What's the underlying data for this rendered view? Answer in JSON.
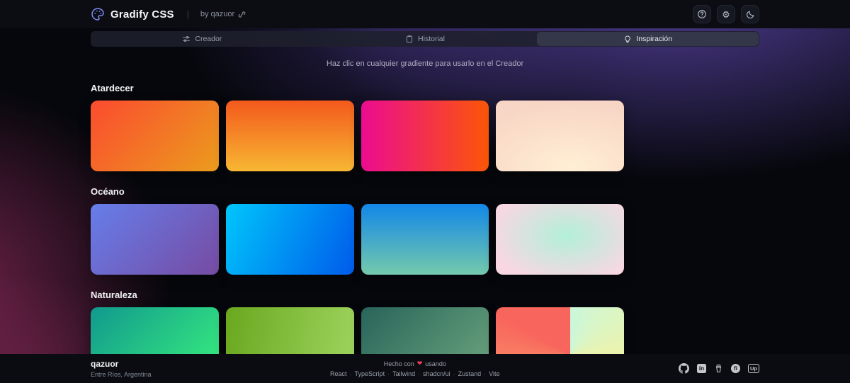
{
  "header": {
    "app_title": "Gradify CSS",
    "separator": "|",
    "byline": "by qazuor",
    "logo_icon": "palette-icon",
    "byline_icon": "link-icon",
    "actions": [
      {
        "icon": "help-icon"
      },
      {
        "icon": "settings-icon"
      },
      {
        "icon": "moon-icon"
      }
    ]
  },
  "tabs": [
    {
      "label": "Creador",
      "icon": "sliders-icon",
      "active": false
    },
    {
      "label": "Historial",
      "icon": "clipboard-icon",
      "active": false
    },
    {
      "label": "Inspiración",
      "icon": "lightbulb-icon",
      "active": true
    }
  ],
  "subtitle": "Haz clic en cualquier gradiente para usarlo en el Creador",
  "sections": [
    {
      "title": "Atardecer",
      "gradients": [
        "linear-gradient(135deg, #fb4b2f 0%, #eb9c1d 100%)",
        "linear-gradient(180deg, #f4591c 0%, #f7b733 100%)",
        "linear-gradient(90deg, #ec0c8f 0%, #fb5607 100%)",
        "radial-gradient(120% 120% at 58% 95%, #ffefd5 0%, #f8d6c5 75%)"
      ]
    },
    {
      "title": "Océano",
      "gradients": [
        "linear-gradient(135deg, #667eea 0%, #764ba2 100%)",
        "linear-gradient(115deg, #00c6fb 0%, #005bea 100%)",
        "linear-gradient(180deg, #1287e8 0%, #74c9ac 100%)",
        "radial-gradient(75% 85% at 55% 45%, #b2f0d9 0%, #f8d7e3 80%)"
      ]
    },
    {
      "title": "Naturaleza",
      "gradients": [
        "linear-gradient(135deg, #11998e 0%, #38ef7d 100%)",
        "linear-gradient(100deg, #6aa81f 0%, #9ed45e 100%)",
        "linear-gradient(135deg, #28645a 0%, #6ca57e 100%)",
        "conic-gradient(from 0deg at 58% 68%, #c9f7dc 0deg, #eef3a9 95deg, #f7d071 165deg, #fba26e 225deg, #f8655c 300deg, #f8655c 360deg)"
      ]
    }
  ],
  "footer": {
    "author": "qazuor",
    "location": "Entre Ríos, Argentina",
    "made_prefix": "Hecho con",
    "heart": "❤",
    "made_suffix": "usando",
    "tech_stack": [
      "React",
      "TypeScript",
      "Tailwind",
      "shadcn/ui",
      "Zustand",
      "Vite"
    ],
    "social_icons": [
      "github-icon",
      "linkedin-icon",
      "coffee-icon",
      "fiverr-icon",
      "upwork-icon"
    ]
  },
  "colors": {
    "accent_indigo": "#818cf8",
    "heart_red": "#f43f5e",
    "background": "#06070c",
    "glow_purple": "#5c46aa",
    "glow_crimson": "#822754"
  }
}
